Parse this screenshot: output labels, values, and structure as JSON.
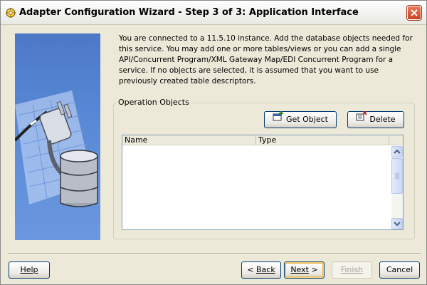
{
  "window": {
    "title": "Adapter Configuration Wizard - Step 3 of 3: Application Interface"
  },
  "description": "You are connected to a 11.5.10 instance. Add the database objects needed for this service. You may add one or more tables/views or you can add a single API/Concurrent Program/XML Gateway Map/EDI Concurrent Program for a service. If no objects are selected, it is assumed that you want to use previously created table descriptors.",
  "operation_objects": {
    "group_label": "Operation Objects",
    "get_object_label": "Get Object",
    "delete_label": "Delete",
    "columns": [
      "Name",
      "Type"
    ],
    "rows": []
  },
  "footer": {
    "help_label": "Help",
    "back_label": "Back",
    "next_label": "Next",
    "finish_label": "Finish",
    "cancel_label": "Cancel"
  },
  "icons": {
    "title": "adapter-wizard-icon",
    "close": "close-icon",
    "get_object": "add-object-icon",
    "delete": "delete-object-icon",
    "illustration": "database-plug-illustration"
  }
}
